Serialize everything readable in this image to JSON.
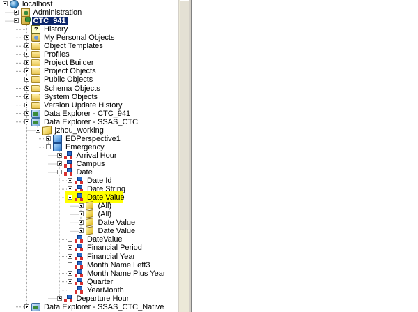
{
  "tree": [
    {
      "label": "localhost",
      "depth": 0,
      "icon": "server-icon",
      "exp": "minus"
    },
    {
      "label": "Administration",
      "depth": 1,
      "icon": "admin-icon",
      "exp": "plus"
    },
    {
      "label": "CTC_941",
      "depth": 1,
      "icon": "project-icon",
      "exp": "minus",
      "selected": true
    },
    {
      "label": "History",
      "depth": 2,
      "icon": "history-icon"
    },
    {
      "label": "My Personal Objects",
      "depth": 2,
      "icon": "personal-objects-icon",
      "exp": "plus"
    },
    {
      "label": "Object Templates",
      "depth": 2,
      "icon": "folder-icon",
      "exp": "plus"
    },
    {
      "label": "Profiles",
      "depth": 2,
      "icon": "folder-icon",
      "exp": "plus"
    },
    {
      "label": "Project Builder",
      "depth": 2,
      "icon": "folder-icon",
      "exp": "plus"
    },
    {
      "label": "Project Objects",
      "depth": 2,
      "icon": "folder-icon",
      "exp": "plus"
    },
    {
      "label": "Public Objects",
      "depth": 2,
      "icon": "folder-icon",
      "exp": "plus"
    },
    {
      "label": "Schema Objects",
      "depth": 2,
      "icon": "folder-icon",
      "exp": "plus"
    },
    {
      "label": "System Objects",
      "depth": 2,
      "icon": "folder-icon",
      "exp": "plus"
    },
    {
      "label": "Version Update History",
      "depth": 2,
      "icon": "folder-icon",
      "exp": "plus"
    },
    {
      "label": "Data Explorer - CTC_941",
      "depth": 2,
      "icon": "data-explorer-icon",
      "exp": "plus"
    },
    {
      "label": "Data Explorer - SSAS_CTC",
      "depth": 2,
      "icon": "data-explorer-icon",
      "exp": "minus"
    },
    {
      "label": "jzhou_working",
      "depth": 3,
      "icon": "catalog-icon",
      "exp": "minus"
    },
    {
      "label": "EDPerspective1",
      "depth": 4,
      "icon": "cube-icon",
      "exp": "plus"
    },
    {
      "label": "Emergency",
      "depth": 4,
      "icon": "cube-icon",
      "exp": "minus"
    },
    {
      "label": "Arrival Hour",
      "depth": 5,
      "icon": "hierarchy-icon",
      "exp": "plus"
    },
    {
      "label": "Campus",
      "depth": 5,
      "icon": "hierarchy-icon",
      "exp": "plus"
    },
    {
      "label": "Date",
      "depth": 5,
      "icon": "hierarchy-icon",
      "exp": "minus"
    },
    {
      "label": "Date Id",
      "depth": 6,
      "icon": "hierarchy-icon",
      "exp": "plus"
    },
    {
      "label": "Date String",
      "depth": 6,
      "icon": "hierarchy-icon",
      "exp": "plus"
    },
    {
      "label": "Date Value",
      "depth": 6,
      "icon": "hierarchy-icon",
      "exp": "minus",
      "highlight": true
    },
    {
      "label": "(All)",
      "depth": 7,
      "icon": "member-icon",
      "exp": "plus"
    },
    {
      "label": "(All)",
      "depth": 7,
      "icon": "member-icon",
      "exp": "plus"
    },
    {
      "label": "Date Value",
      "depth": 7,
      "icon": "member-icon",
      "exp": "plus"
    },
    {
      "label": "Date Value",
      "depth": 7,
      "icon": "member-icon",
      "exp": "plus"
    },
    {
      "label": "DateValue",
      "depth": 6,
      "icon": "hierarchy-icon",
      "exp": "plus"
    },
    {
      "label": "Financial Period",
      "depth": 6,
      "icon": "hierarchy-icon",
      "exp": "plus"
    },
    {
      "label": "Financial Year",
      "depth": 6,
      "icon": "hierarchy-icon",
      "exp": "plus"
    },
    {
      "label": "Month Name Left3",
      "depth": 6,
      "icon": "hierarchy-icon",
      "exp": "plus"
    },
    {
      "label": "Month Name Plus Year",
      "depth": 6,
      "icon": "hierarchy-icon",
      "exp": "plus"
    },
    {
      "label": "Quarter",
      "depth": 6,
      "icon": "hierarchy-icon",
      "exp": "plus"
    },
    {
      "label": "YearMonth",
      "depth": 6,
      "icon": "hierarchy-icon",
      "exp": "plus"
    },
    {
      "label": "Departure Hour",
      "depth": 5,
      "icon": "hierarchy-icon",
      "exp": "plus"
    },
    {
      "label": "Data Explorer - SSAS_CTC_Native",
      "depth": 2,
      "icon": "data-explorer-icon",
      "exp": "plus"
    }
  ],
  "colors": {
    "selection_bg": "#0a246a",
    "selection_fg": "#ffffff",
    "highlight": "#ffff00"
  }
}
